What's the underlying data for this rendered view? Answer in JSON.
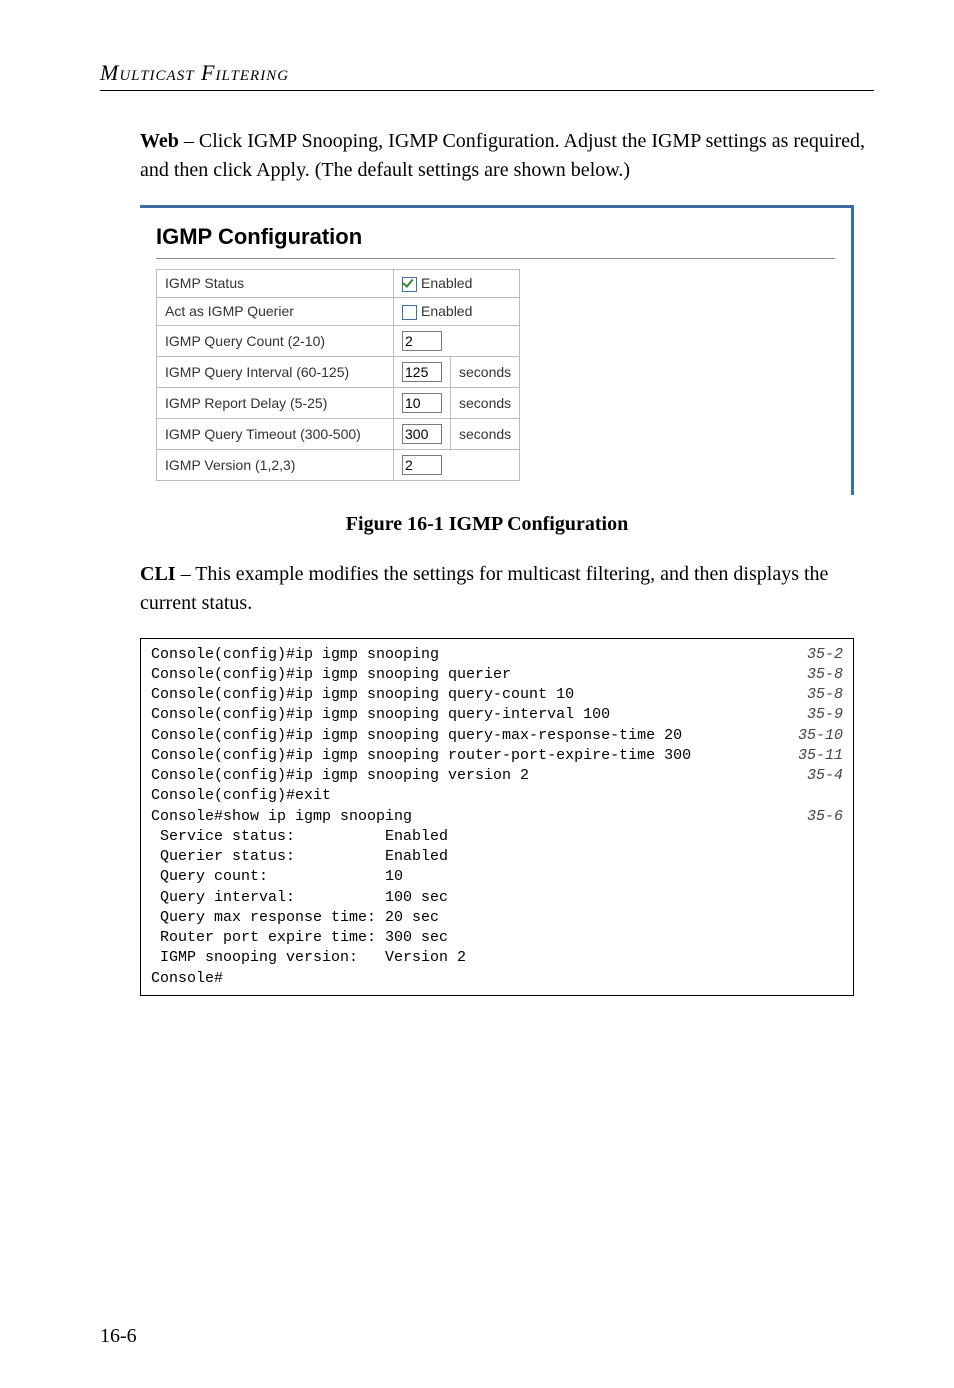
{
  "header": {
    "running_head": "Multicast Filtering"
  },
  "intro": {
    "lead_bold": "Web",
    "lead_rest": " – Click IGMP Snooping, IGMP Configuration. Adjust the IGMP settings as required, and then click Apply. (The default settings are shown below.)"
  },
  "panel": {
    "title": "IGMP Configuration",
    "rows": {
      "igmp_status": {
        "label": "IGMP Status",
        "enabled_label": "Enabled",
        "checked": true
      },
      "act_querier": {
        "label": "Act as IGMP Querier",
        "enabled_label": "Enabled",
        "checked": false
      },
      "query_count": {
        "label": "IGMP Query Count (2-10)",
        "value": "2"
      },
      "query_interval": {
        "label": "IGMP Query Interval (60-125)",
        "value": "125",
        "unit": "seconds"
      },
      "report_delay": {
        "label": "IGMP Report Delay (5-25)",
        "value": "10",
        "unit": "seconds"
      },
      "query_timeout": {
        "label": "IGMP Query Timeout (300-500)",
        "value": "300",
        "unit": "seconds"
      },
      "version": {
        "label": "IGMP Version (1,2,3)",
        "value": "2"
      }
    }
  },
  "figure_caption": "Figure 16-1  IGMP Configuration",
  "cli_intro": {
    "lead_bold": "CLI",
    "lead_rest": " – This example modifies the settings for multicast filtering, and then displays the current status."
  },
  "cli": [
    {
      "text": "Console(config)#ip igmp snooping",
      "ref": "35-2"
    },
    {
      "text": "Console(config)#ip igmp snooping querier",
      "ref": "35-8"
    },
    {
      "text": "Console(config)#ip igmp snooping query-count 10",
      "ref": "35-8"
    },
    {
      "text": "Console(config)#ip igmp snooping query-interval 100",
      "ref": "35-9"
    },
    {
      "text": "Console(config)#ip igmp snooping query-max-response-time 20",
      "ref": "35-10"
    },
    {
      "text": "Console(config)#ip igmp snooping router-port-expire-time 300",
      "ref": "35-11"
    },
    {
      "text": "Console(config)#ip igmp snooping version 2",
      "ref": "35-4"
    },
    {
      "text": "Console(config)#exit",
      "ref": ""
    },
    {
      "text": "Console#show ip igmp snooping",
      "ref": "35-6"
    },
    {
      "text": " Service status:          Enabled",
      "ref": ""
    },
    {
      "text": " Querier status:          Enabled",
      "ref": ""
    },
    {
      "text": " Query count:             10",
      "ref": ""
    },
    {
      "text": " Query interval:          100 sec",
      "ref": ""
    },
    {
      "text": " Query max response time: 20 sec",
      "ref": ""
    },
    {
      "text": " Router port expire time: 300 sec",
      "ref": ""
    },
    {
      "text": " IGMP snooping version:   Version 2",
      "ref": ""
    },
    {
      "text": "Console#",
      "ref": ""
    }
  ],
  "page_number": "16-6"
}
